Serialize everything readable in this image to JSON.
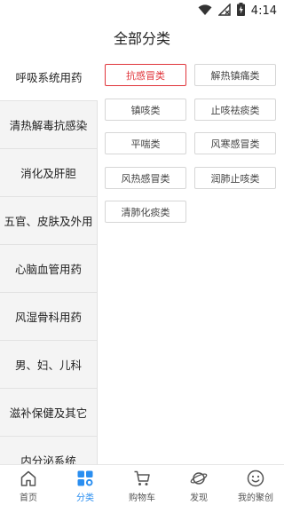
{
  "status": {
    "time": "4:14"
  },
  "header": {
    "title": "全部分类"
  },
  "sidebar": {
    "items": [
      {
        "label": "呼吸系统用药",
        "active": true
      },
      {
        "label": "清热解毒抗感染",
        "active": false
      },
      {
        "label": "消化及肝胆",
        "active": false
      },
      {
        "label": "五官、皮肤及外用",
        "active": false
      },
      {
        "label": "心脑血管用药",
        "active": false
      },
      {
        "label": "风湿骨科用药",
        "active": false
      },
      {
        "label": "男、妇、儿科",
        "active": false
      },
      {
        "label": "滋补保健及其它",
        "active": false
      },
      {
        "label": "内分泌系统",
        "active": false
      }
    ]
  },
  "subcategories": [
    {
      "label": "抗感冒类",
      "active": true
    },
    {
      "label": "解热镇痛类",
      "active": false
    },
    {
      "label": "镇咳类",
      "active": false
    },
    {
      "label": "止咳祛痰类",
      "active": false
    },
    {
      "label": "平喘类",
      "active": false
    },
    {
      "label": "风寒感冒类",
      "active": false
    },
    {
      "label": "风热感冒类",
      "active": false
    },
    {
      "label": "润肺止咳类",
      "active": false
    },
    {
      "label": "清肺化痰类",
      "active": false
    }
  ],
  "tabbar": {
    "tabs": [
      {
        "label": "首页",
        "icon": "home-icon",
        "active": false
      },
      {
        "label": "分类",
        "icon": "category-grid-icon",
        "active": true
      },
      {
        "label": "购物车",
        "icon": "cart-icon",
        "active": false
      },
      {
        "label": "发现",
        "icon": "planet-icon",
        "active": false
      },
      {
        "label": "我的聚创",
        "icon": "smile-icon",
        "active": false
      }
    ]
  },
  "colors": {
    "accent_red": "#e0353b",
    "active_blue": "#2a8ef0"
  }
}
